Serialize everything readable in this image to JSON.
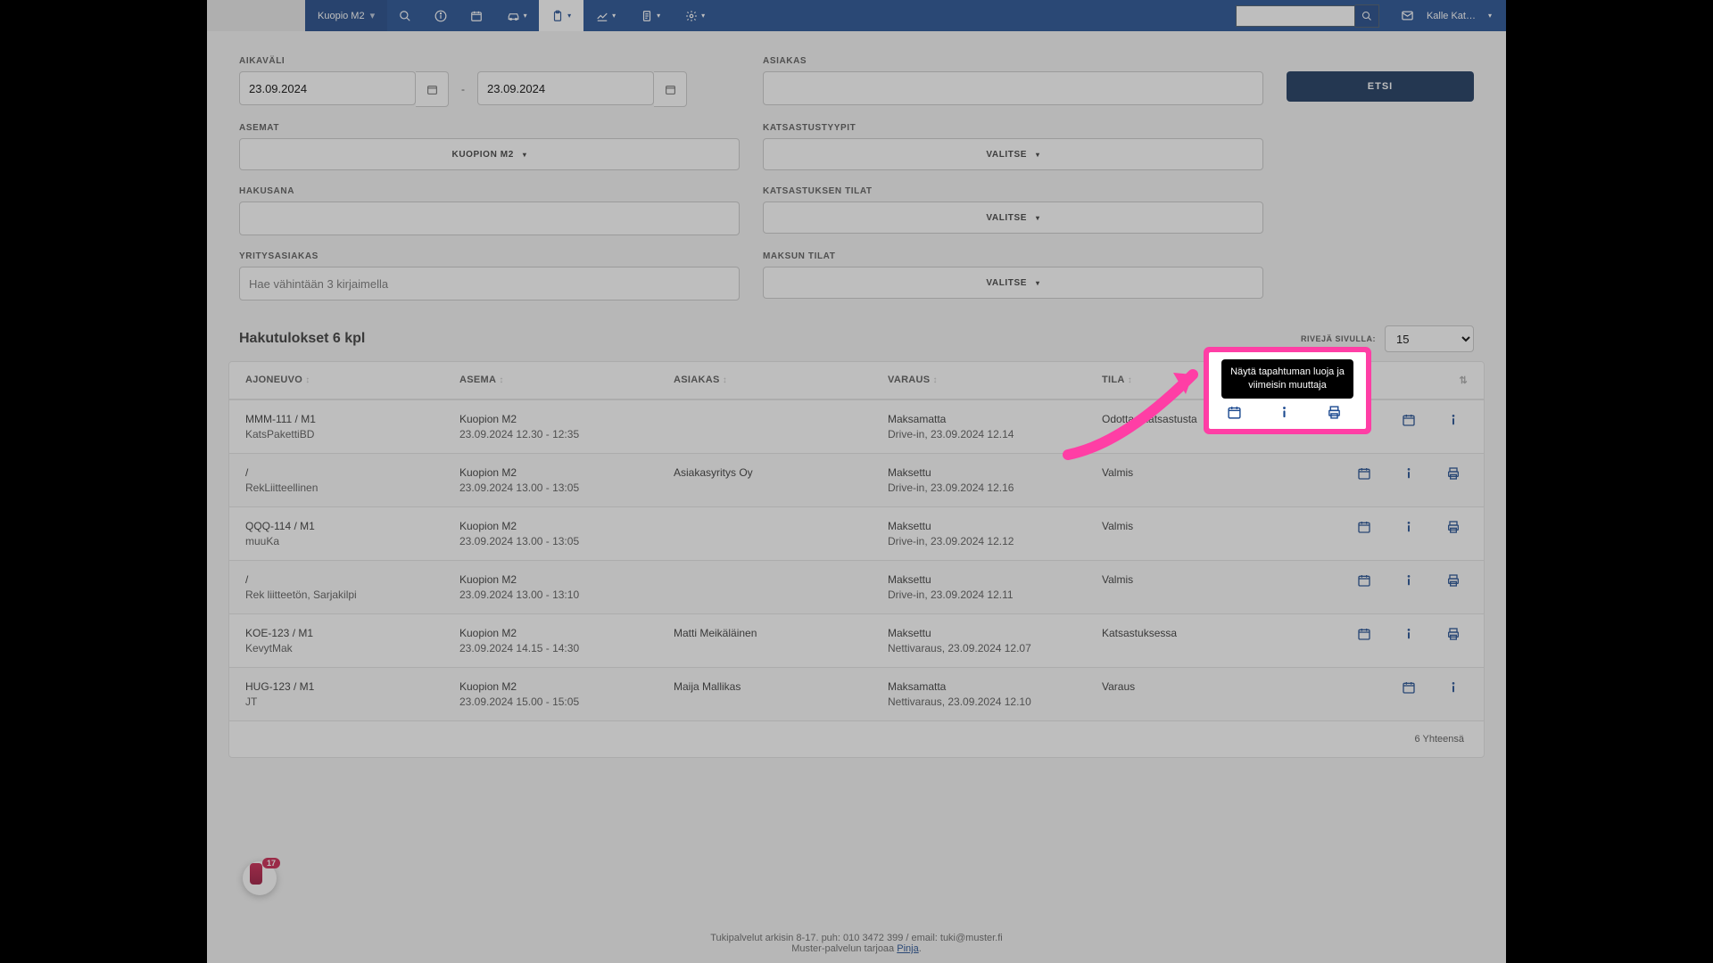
{
  "nav": {
    "station": "Kuopio M2",
    "user": "Kalle Kat…",
    "search_placeholder": ""
  },
  "filters": {
    "aikavali_label": "AIKAVÄLI",
    "date_from": "23.09.2024",
    "date_to": "23.09.2024",
    "asemat_label": "ASEMAT",
    "asemat_value": "KUOPION M2",
    "hakusana_label": "HAKUSANA",
    "hakusana_value": "",
    "yritys_label": "YRITYSASIAKAS",
    "yritys_placeholder": "Hae vähintään 3 kirjaimella",
    "asiakas_label": "ASIAKAS",
    "asiakas_value": "",
    "tyypit_label": "KATSASTUSTYYPIT",
    "tyypit_value": "VALITSE",
    "katsastus_tilat_label": "KATSASTUKSEN TILAT",
    "katsastus_tilat_value": "VALITSE",
    "maksu_tilat_label": "MAKSUN TILAT",
    "maksu_tilat_value": "VALITSE",
    "etsi": "ETSI"
  },
  "results": {
    "title": "Hakutulokset 6 kpl",
    "rpp_label": "RIVEJÄ SIVULLA:",
    "rpp_value": "15",
    "footer": "6 Yhteensä"
  },
  "columns": {
    "ajoneuvo": "AJONEUVO",
    "asema": "ASEMA",
    "asiakas": "ASIAKAS",
    "varaus": "VARAUS",
    "tila": "TILA"
  },
  "rows": [
    {
      "veh1": "MMM-111 / M1",
      "veh2": "KatsPakettiBD",
      "asema1": "Kuopion M2",
      "asema2": "23.09.2024 12.30 - 12:35",
      "asiakas": "",
      "var1": "Maksamatta",
      "var2": "Drive-in, 23.09.2024 12.14",
      "tila": "Odottaa katsastusta",
      "actions": [
        "cal",
        "info"
      ]
    },
    {
      "veh1": "/",
      "veh2": "RekLiitteellinen",
      "asema1": "Kuopion M2",
      "asema2": "23.09.2024 13.00 - 13:05",
      "asiakas": "Asiakasyritys Oy",
      "var1": "Maksettu",
      "var2": "Drive-in, 23.09.2024 12.16",
      "tila": "Valmis",
      "actions": [
        "cal",
        "info",
        "print"
      ]
    },
    {
      "veh1": "QQQ-114 / M1",
      "veh2": "muuKa",
      "asema1": "Kuopion M2",
      "asema2": "23.09.2024 13.00 - 13:05",
      "asiakas": "",
      "var1": "Maksettu",
      "var2": "Drive-in, 23.09.2024 12.12",
      "tila": "Valmis",
      "actions": [
        "cal",
        "info",
        "print"
      ]
    },
    {
      "veh1": "/",
      "veh2": "Rek liitteetön, Sarjakilpi",
      "asema1": "Kuopion M2",
      "asema2": "23.09.2024 13.00 - 13:10",
      "asiakas": "",
      "var1": "Maksettu",
      "var2": "Drive-in, 23.09.2024 12.11",
      "tila": "Valmis",
      "actions": [
        "cal",
        "info",
        "print"
      ]
    },
    {
      "veh1": "KOE-123 / M1",
      "veh2": "KevytMak",
      "asema1": "Kuopion M2",
      "asema2": "23.09.2024 14.15 - 14:30",
      "asiakas": "Matti Meikäläinen",
      "var1": "Maksettu",
      "var2": "Nettivaraus, 23.09.2024 12.07",
      "tila": "Katsastuksessa",
      "actions": [
        "cal",
        "info",
        "print"
      ]
    },
    {
      "veh1": "HUG-123 / M1",
      "veh2": "JT",
      "asema1": "Kuopion M2",
      "asema2": "23.09.2024 15.00 - 15:05",
      "asiakas": "Maija Mallikas",
      "var1": "Maksamatta",
      "var2": "Nettivaraus, 23.09.2024 12.10",
      "tila": "Varaus",
      "actions": [
        "cal",
        "info"
      ]
    }
  ],
  "tooltip": "Näytä tapahtuman luoja ja viimeisin muuttaja",
  "notif_badge": "17",
  "footer": {
    "line1": "Tukipalvelut arkisin 8-17. puh: 010 3472 399 / email: tuki@muster.fi",
    "line2_a": "Muster-palvelun tarjoaa ",
    "line2_link": "Pinja",
    "line2_b": "."
  }
}
